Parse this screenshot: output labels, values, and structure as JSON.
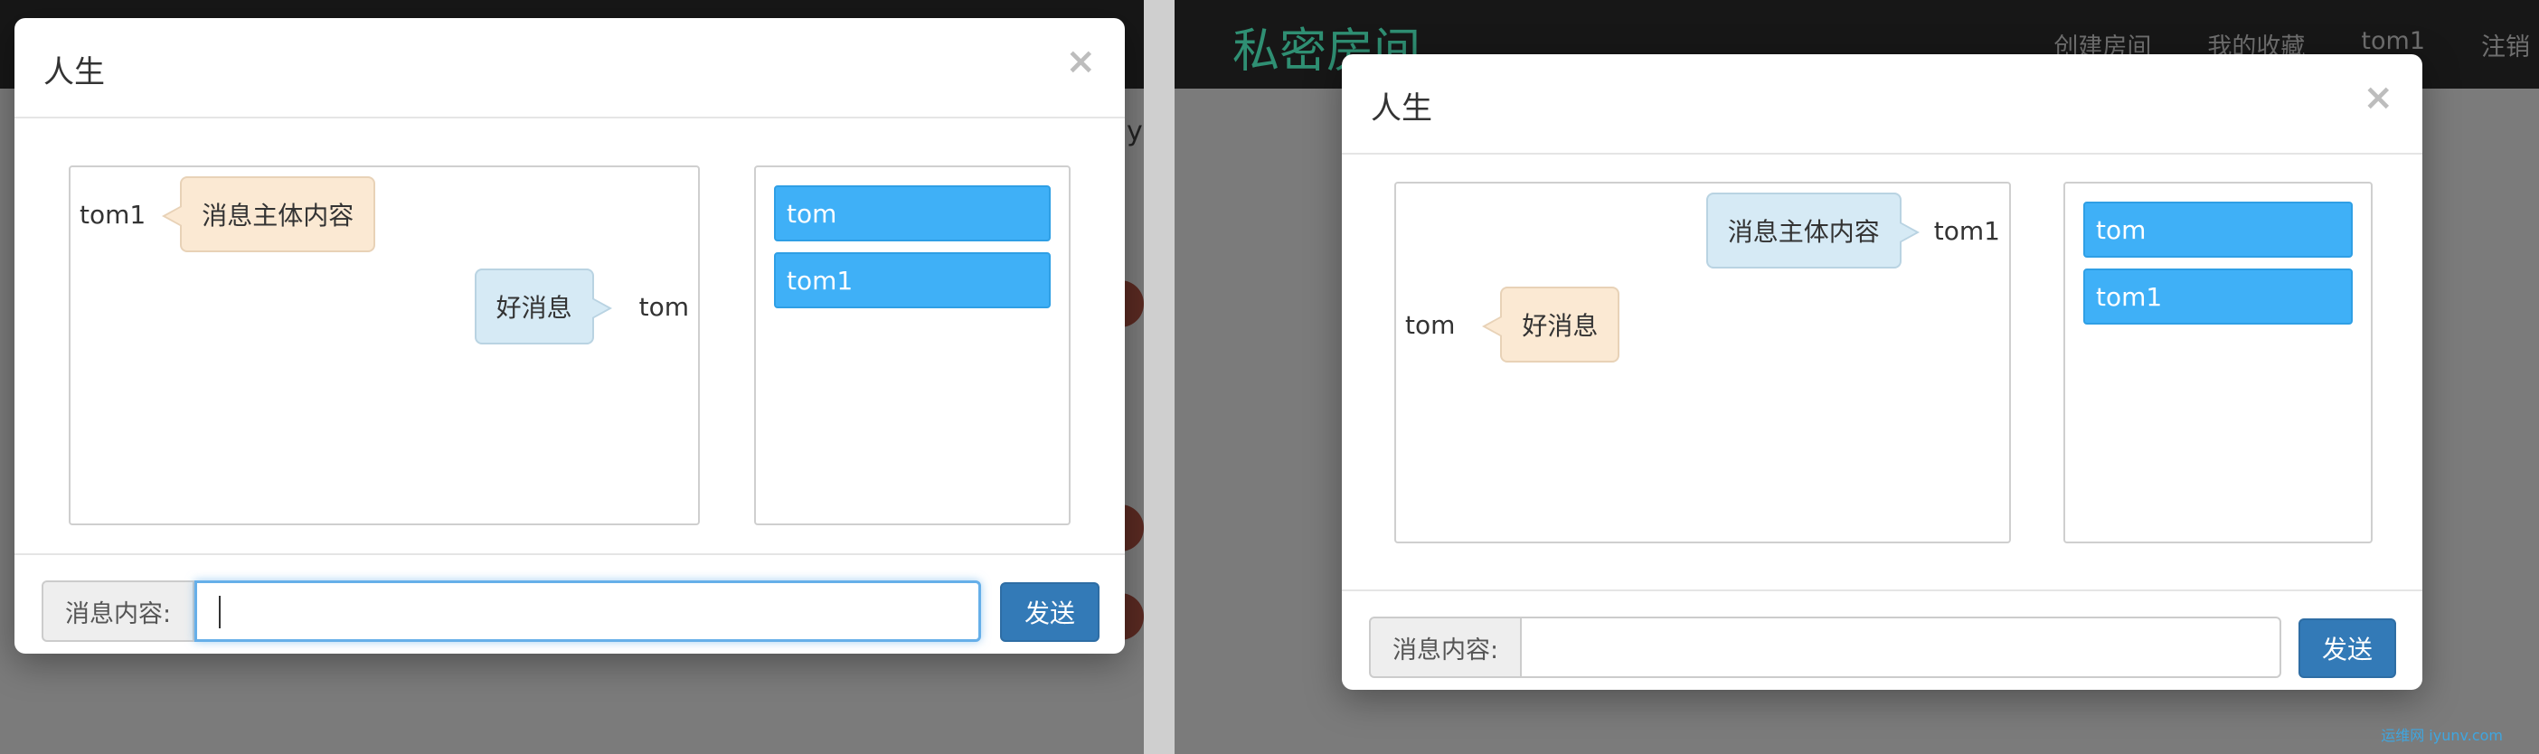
{
  "background": {
    "brand": "私密房间",
    "nav_links": [
      "创建房间",
      "我的收藏",
      "tom1",
      "注销"
    ],
    "partial_text": "y"
  },
  "left_modal": {
    "title": "人生",
    "close": "×",
    "messages": [
      {
        "name": "tom1",
        "text": "消息主体内容"
      },
      {
        "name": "tom",
        "text": "好消息"
      }
    ],
    "users": [
      "tom",
      "tom1"
    ],
    "input_label": "消息内容:",
    "input_value": "",
    "send_label": "发送"
  },
  "right_modal": {
    "title": "人生",
    "close": "×",
    "messages": [
      {
        "name": "tom1",
        "text": "消息主体内容"
      },
      {
        "name": "tom",
        "text": "好消息"
      }
    ],
    "users": [
      "tom",
      "tom1"
    ],
    "input_label": "消息内容:",
    "input_value": "",
    "send_label": "发送"
  },
  "watermark": "运维网 iyunv.com",
  "colors": {
    "user_item": "#3fb0f7",
    "send_button": "#337ab7",
    "bubble_tan": "#fbe9d3",
    "bubble_blue": "#d6eaf5",
    "brand": "#2f8f73"
  }
}
